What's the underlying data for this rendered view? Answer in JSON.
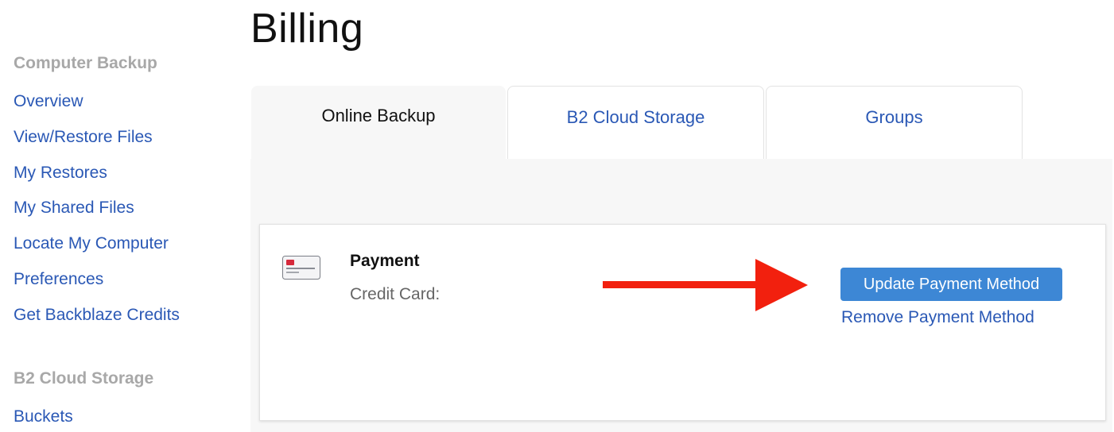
{
  "page": {
    "title": "Billing"
  },
  "sidebar": {
    "sections": [
      {
        "heading": "Computer Backup",
        "items": [
          {
            "label": "Overview"
          },
          {
            "label": "View/Restore Files"
          },
          {
            "label": "My Restores"
          },
          {
            "label": "My Shared Files"
          },
          {
            "label": "Locate My Computer"
          },
          {
            "label": "Preferences"
          },
          {
            "label": "Get Backblaze Credits"
          }
        ]
      },
      {
        "heading": "B2 Cloud Storage",
        "items": [
          {
            "label": "Buckets"
          }
        ]
      }
    ]
  },
  "tabs": [
    {
      "label": "Online Backup",
      "active": true
    },
    {
      "label": "B2 Cloud Storage",
      "active": false
    },
    {
      "label": "Groups",
      "active": false
    }
  ],
  "payment": {
    "icon": "credit-card-icon",
    "title": "Payment",
    "credit_card_label": "Credit Card:",
    "update_button": "Update Payment Method",
    "remove_link": "Remove Payment Method"
  },
  "annotation": {
    "icon": "arrow-right-icon",
    "color": "#f2200e"
  },
  "colors": {
    "link": "#2a58b5",
    "button": "#3d87d5",
    "heading_muted": "#a8a8a8",
    "panel_bg": "#f7f7f7"
  }
}
